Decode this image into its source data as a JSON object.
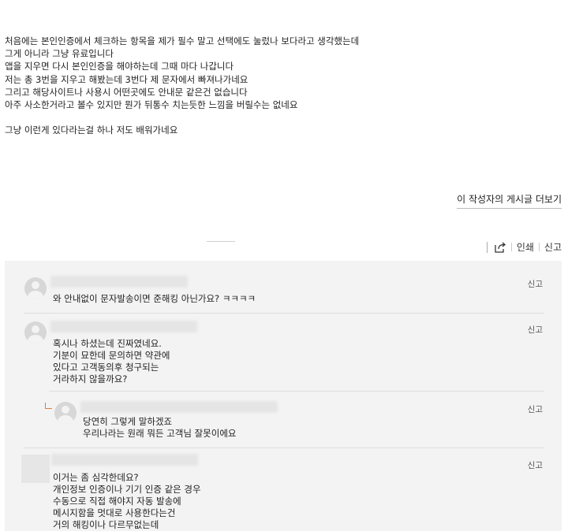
{
  "post": {
    "lines": [
      "처음에는 본인인증에서 체크하는 항목을 제가 필수 말고 선택에도 눌렀나 보다라고 생각했는데",
      "그게 아니라 그냥 유료입니다",
      "앱을 지우면 다시 본인인증을 해야하는데 그때 마다 나갑니다",
      "저는 총 3번을 지우고 해봤는데 3번다 제 문자에서 빠져나가네요",
      "그리고 해당사이트나 사용시 어떤곳에도 안내문 같은건 없습니다",
      "아주 사소한거라고 볼수 있지만 뭔가 뒤통수 치는듯한 느낌을 버릴수는 없네요"
    ],
    "closing": "그냥 이런게 있다라는걸 하나 저도 배워가네요"
  },
  "more_posts": "이 작성자의 게시글 더보기",
  "tools": {
    "print": "인쇄",
    "report": "신고",
    "share_icon": "share-icon"
  },
  "comments": [
    {
      "report": "신고",
      "lines": [
        "와 안내없이 문자발송이면 준해킹 아닌가요? ㅋㅋㅋㅋ"
      ]
    },
    {
      "report": "신고",
      "lines": [
        "혹시나 하셨는데 진짜였네요.",
        "기분이 묘한데 문의하면 약관에",
        "있다고 고객동의후 청구되는",
        "거라하지 않을까요?"
      ]
    },
    {
      "report": "신고",
      "reply": true,
      "lines": [
        "당연히 그렇게 말하겠죠",
        "우리나라는 원래 뭐든 고객님 잘못이에요"
      ]
    },
    {
      "report": "신고",
      "lines": [
        "이거는 좀 심각한데요?",
        "개인정보 인증이나 기기 인증 같은 경우",
        "수동으로 직접 해야지 자동 발송에",
        "메시지함을 멋대로 사용한다는건",
        "거의 해킹이나 다르무없는데"
      ]
    }
  ]
}
